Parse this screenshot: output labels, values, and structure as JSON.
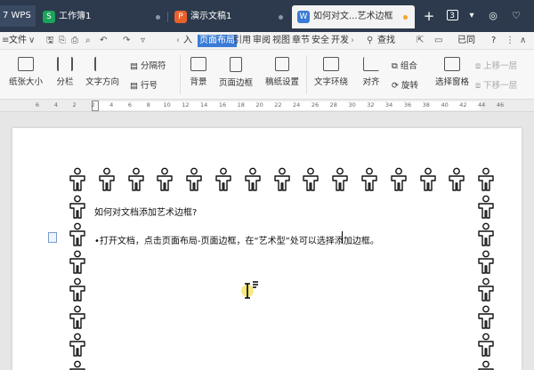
{
  "tabs": {
    "wps_label": "7 WPS",
    "items": [
      {
        "label": "工作簿1",
        "icon_char": "S",
        "color": "#1aa35a"
      },
      {
        "label": "演示文稿1",
        "icon_char": "P",
        "color": "#e8612c"
      },
      {
        "label": "如何对文...艺术边框",
        "icon_char": "W",
        "color": "#3a7bd5"
      }
    ],
    "new_tab": "+",
    "tab_count": "3"
  },
  "menubar": {
    "file": "文件",
    "enter_label": "入",
    "items": [
      "页面布局",
      "引用",
      "审阅",
      "视图",
      "章节",
      "安全",
      "开发"
    ],
    "search": "查找",
    "sync_label": "已同",
    "help": "?"
  },
  "ribbon": {
    "paper_size": "纸张大小",
    "columns": "分栏",
    "text_direction": "文字方向",
    "separator": "分隔符",
    "line_number": "行号",
    "background": "背景",
    "page_border": "页面边框",
    "manuscript": "稿纸设置",
    "text_wrap": "文字环绕",
    "align": "对齐",
    "group": "组合",
    "rotate": "旋转",
    "selection_pane": "选择窗格",
    "bring_forward": "上移一层",
    "send_backward": "下移一层"
  },
  "ruler": {
    "ticks": [
      "6",
      "4",
      "2",
      "2",
      "4",
      "6",
      "8",
      "10",
      "12",
      "14",
      "16",
      "18",
      "20",
      "22",
      "24",
      "26",
      "28",
      "30",
      "32",
      "34",
      "36",
      "38",
      "40",
      "42",
      "44",
      "46"
    ]
  },
  "document": {
    "heading": "如何对文档添加艺术边框?",
    "body_before": "•打开文档，点击页面布局-页面边框，在“艺术型”处可以",
    "body_after": "选择添加边框。"
  }
}
